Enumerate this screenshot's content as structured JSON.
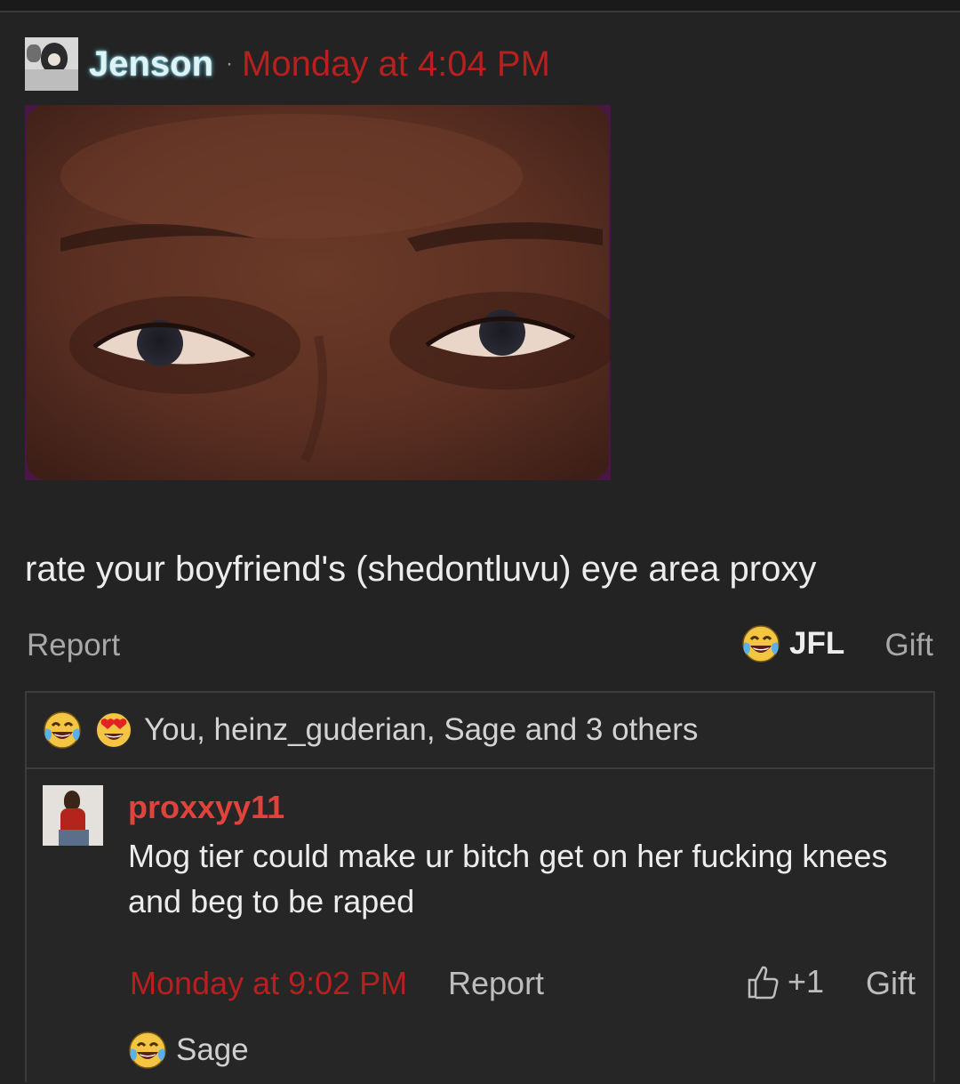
{
  "post": {
    "author": "Jenson",
    "separator": "·",
    "timestamp": "Monday at 4:04 PM",
    "text": "rate your boyfriend's (shedontluvu) eye area proxy",
    "actions": {
      "report_label": "Report",
      "reaction_label": "JFL",
      "gift_label": "Gift"
    }
  },
  "reactions": {
    "icons": [
      "laughing-crying-icon",
      "heart-eyes-icon"
    ],
    "summary": "You, heinz_guderian, Sage and 3 others"
  },
  "comment": {
    "author": "proxxyy11",
    "body": "Mog tier could make ur bitch get on her fucking knees and beg to be raped",
    "timestamp": "Monday at 9:02 PM",
    "report_label": "Report",
    "like_count": "+1",
    "gift_label": "Gift",
    "reaction_user": "Sage",
    "reaction_icon": "laughing-crying-icon"
  },
  "colors": {
    "background": "#232323",
    "timestamp_red": "#b81f1f",
    "comment_author_red": "#e0433b",
    "author_glow": "#78dcf0"
  }
}
